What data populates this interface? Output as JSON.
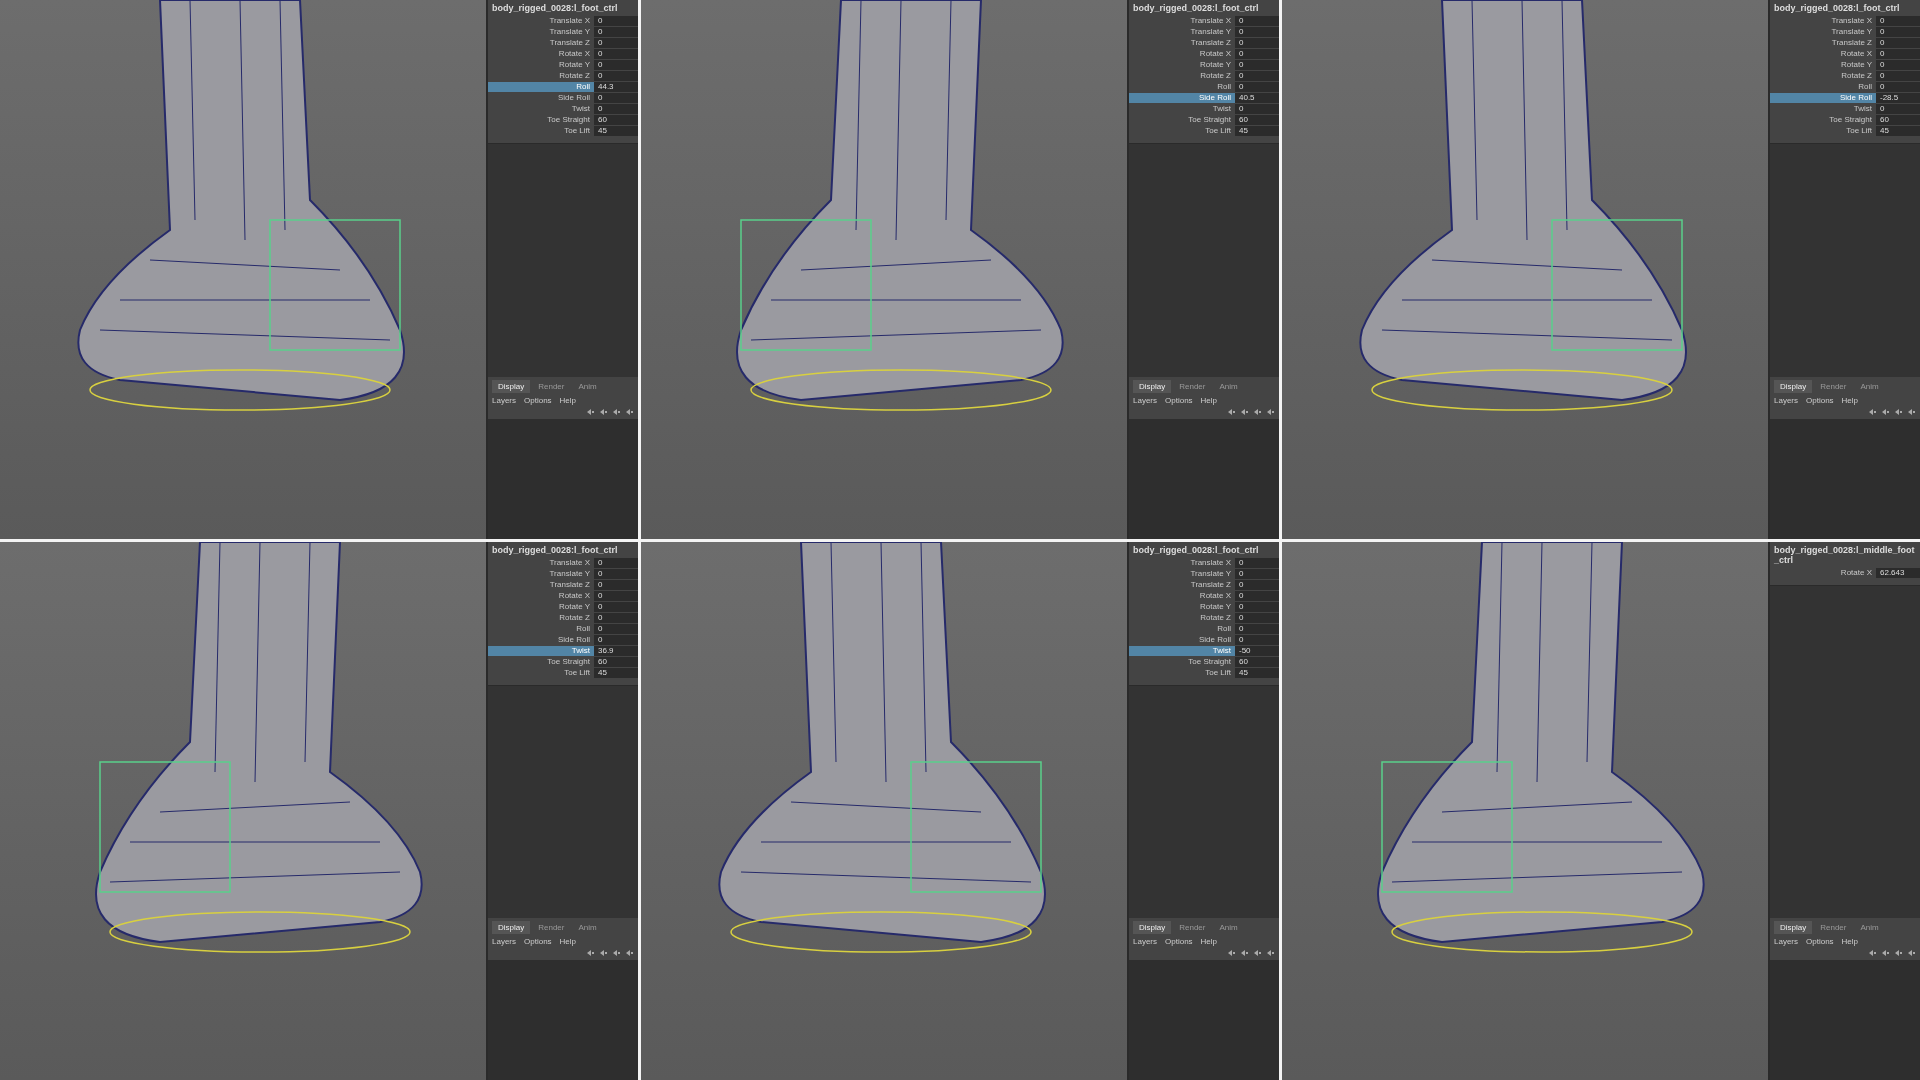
{
  "panels": [
    {
      "node": "body_rigged_0028:l_foot_ctrl",
      "attributes": [
        {
          "name": "Translate X",
          "value": "0",
          "selected": false
        },
        {
          "name": "Translate Y",
          "value": "0",
          "selected": false
        },
        {
          "name": "Translate Z",
          "value": "0",
          "selected": false
        },
        {
          "name": "Rotate X",
          "value": "0",
          "selected": false
        },
        {
          "name": "Rotate Y",
          "value": "0",
          "selected": false
        },
        {
          "name": "Rotate Z",
          "value": "0",
          "selected": false
        },
        {
          "name": "Roll",
          "value": "44.3",
          "selected": true
        },
        {
          "name": "Side Roll",
          "value": "0",
          "selected": false
        },
        {
          "name": "Twist",
          "value": "0",
          "selected": false
        },
        {
          "name": "Toe Straight",
          "value": "60",
          "selected": false
        },
        {
          "name": "Toe Lift",
          "value": "45",
          "selected": false
        }
      ],
      "layer_tabs": [
        {
          "label": "Display",
          "selected": true
        },
        {
          "label": "Render",
          "selected": false
        },
        {
          "label": "Anim",
          "selected": false
        }
      ],
      "layer_menu": [
        "Layers",
        "Options",
        "Help"
      ]
    },
    {
      "node": "body_rigged_0028:l_foot_ctrl",
      "attributes": [
        {
          "name": "Translate X",
          "value": "0",
          "selected": false
        },
        {
          "name": "Translate Y",
          "value": "0",
          "selected": false
        },
        {
          "name": "Translate Z",
          "value": "0",
          "selected": false
        },
        {
          "name": "Rotate X",
          "value": "0",
          "selected": false
        },
        {
          "name": "Rotate Y",
          "value": "0",
          "selected": false
        },
        {
          "name": "Rotate Z",
          "value": "0",
          "selected": false
        },
        {
          "name": "Roll",
          "value": "0",
          "selected": false
        },
        {
          "name": "Side Roll",
          "value": "40.5",
          "selected": true
        },
        {
          "name": "Twist",
          "value": "0",
          "selected": false
        },
        {
          "name": "Toe Straight",
          "value": "60",
          "selected": false
        },
        {
          "name": "Toe Lift",
          "value": "45",
          "selected": false
        }
      ],
      "layer_tabs": [
        {
          "label": "Display",
          "selected": true
        },
        {
          "label": "Render",
          "selected": false
        },
        {
          "label": "Anim",
          "selected": false
        }
      ],
      "layer_menu": [
        "Layers",
        "Options",
        "Help"
      ]
    },
    {
      "node": "body_rigged_0028:l_foot_ctrl",
      "attributes": [
        {
          "name": "Translate X",
          "value": "0",
          "selected": false
        },
        {
          "name": "Translate Y",
          "value": "0",
          "selected": false
        },
        {
          "name": "Translate Z",
          "value": "0",
          "selected": false
        },
        {
          "name": "Rotate X",
          "value": "0",
          "selected": false
        },
        {
          "name": "Rotate Y",
          "value": "0",
          "selected": false
        },
        {
          "name": "Rotate Z",
          "value": "0",
          "selected": false
        },
        {
          "name": "Roll",
          "value": "0",
          "selected": false
        },
        {
          "name": "Side Roll",
          "value": "-28.5",
          "selected": true
        },
        {
          "name": "Twist",
          "value": "0",
          "selected": false
        },
        {
          "name": "Toe Straight",
          "value": "60",
          "selected": false
        },
        {
          "name": "Toe Lift",
          "value": "45",
          "selected": false
        }
      ],
      "layer_tabs": [
        {
          "label": "Display",
          "selected": true
        },
        {
          "label": "Render",
          "selected": false
        },
        {
          "label": "Anim",
          "selected": false
        }
      ],
      "layer_menu": [
        "Layers",
        "Options",
        "Help"
      ]
    },
    {
      "node": "body_rigged_0028:l_foot_ctrl",
      "attributes": [
        {
          "name": "Translate X",
          "value": "0",
          "selected": false
        },
        {
          "name": "Translate Y",
          "value": "0",
          "selected": false
        },
        {
          "name": "Translate Z",
          "value": "0",
          "selected": false
        },
        {
          "name": "Rotate X",
          "value": "0",
          "selected": false
        },
        {
          "name": "Rotate Y",
          "value": "0",
          "selected": false
        },
        {
          "name": "Rotate Z",
          "value": "0",
          "selected": false
        },
        {
          "name": "Roll",
          "value": "0",
          "selected": false
        },
        {
          "name": "Side Roll",
          "value": "0",
          "selected": false
        },
        {
          "name": "Twist",
          "value": "36.9",
          "selected": true
        },
        {
          "name": "Toe Straight",
          "value": "60",
          "selected": false
        },
        {
          "name": "Toe Lift",
          "value": "45",
          "selected": false
        }
      ],
      "layer_tabs": [
        {
          "label": "Display",
          "selected": true
        },
        {
          "label": "Render",
          "selected": false
        },
        {
          "label": "Anim",
          "selected": false
        }
      ],
      "layer_menu": [
        "Layers",
        "Options",
        "Help"
      ]
    },
    {
      "node": "body_rigged_0028:l_foot_ctrl",
      "attributes": [
        {
          "name": "Translate X",
          "value": "0",
          "selected": false
        },
        {
          "name": "Translate Y",
          "value": "0",
          "selected": false
        },
        {
          "name": "Translate Z",
          "value": "0",
          "selected": false
        },
        {
          "name": "Rotate X",
          "value": "0",
          "selected": false
        },
        {
          "name": "Rotate Y",
          "value": "0",
          "selected": false
        },
        {
          "name": "Rotate Z",
          "value": "0",
          "selected": false
        },
        {
          "name": "Roll",
          "value": "0",
          "selected": false
        },
        {
          "name": "Side Roll",
          "value": "0",
          "selected": false
        },
        {
          "name": "Twist",
          "value": "-50",
          "selected": true
        },
        {
          "name": "Toe Straight",
          "value": "60",
          "selected": false
        },
        {
          "name": "Toe Lift",
          "value": "45",
          "selected": false
        }
      ],
      "layer_tabs": [
        {
          "label": "Display",
          "selected": true
        },
        {
          "label": "Render",
          "selected": false
        },
        {
          "label": "Anim",
          "selected": false
        }
      ],
      "layer_menu": [
        "Layers",
        "Options",
        "Help"
      ]
    },
    {
      "node": "body_rigged_0028:l_middle_foot_ctrl",
      "attributes": [
        {
          "name": "Rotate X",
          "value": "62.643",
          "selected": false
        }
      ],
      "layer_tabs": [
        {
          "label": "Display",
          "selected": true
        },
        {
          "label": "Render",
          "selected": false
        },
        {
          "label": "Anim",
          "selected": false
        }
      ],
      "layer_menu": [
        "Layers",
        "Options",
        "Help"
      ]
    }
  ]
}
